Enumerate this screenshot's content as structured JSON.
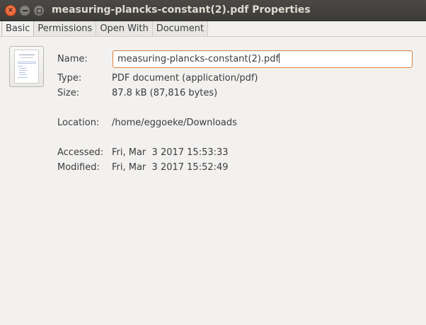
{
  "window": {
    "title": "measuring-plancks-constant(2).pdf Properties",
    "close_glyph": "×"
  },
  "tabs": [
    {
      "label": "Basic",
      "active": true
    },
    {
      "label": "Permissions",
      "active": false
    },
    {
      "label": "Open With",
      "active": false
    },
    {
      "label": "Document",
      "active": false
    }
  ],
  "basic": {
    "name_label": "Name:",
    "name_value": "measuring-plancks-constant(2).pdf",
    "type_label": "Type:",
    "type_value": "PDF document (application/pdf)",
    "size_label": "Size:",
    "size_value": "87.8 kB (87,816 bytes)",
    "location_label": "Location:",
    "location_value": "/home/eggoeke/Downloads",
    "accessed_label": "Accessed:",
    "accessed_value": "Fri, Mar  3 2017 15:53:33",
    "modified_label": "Modified:",
    "modified_value": "Fri, Mar  3 2017 15:52:49"
  },
  "icons": {
    "file": "pdf-file-thumbnail-icon"
  },
  "colors": {
    "titlebar": "#3c3b37",
    "close_button": "#e1531f",
    "focus_border": "#e0823d"
  }
}
